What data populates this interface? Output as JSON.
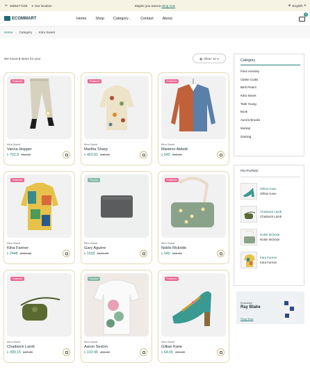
{
  "topbar": {
    "phone": "1555477155",
    "location": "Our location",
    "promo_text": "Maybe you wanna",
    "promo_link": "shop now",
    "language": "English"
  },
  "header": {
    "logo": "ECOMMART",
    "nav": [
      "Home",
      "Shop",
      "Category",
      "Contact",
      "About"
    ],
    "cart_count": "0"
  },
  "breadcrumb": [
    "Home",
    "Category",
    "Kitra Sweet"
  ],
  "listing": {
    "found_prefix": "We found ",
    "found_count": "9",
    "found_suffix": " items for you!",
    "show_label": "Show: 12"
  },
  "products": [
    {
      "badge": "Featured",
      "vendor": "Kitra Sweet",
      "name": "Vanna Hopper",
      "price": "702.9",
      "old_price": "756.00"
    },
    {
      "badge": "Featured",
      "vendor": "Kitra Sweet",
      "name": "Martha Sharp",
      "price": "453.91",
      "old_price": "505.00"
    },
    {
      "badge": "Featured",
      "vendor": "Kitra Sweet",
      "name": "Marteno Abbott",
      "price": "540",
      "old_price": "600.00"
    },
    {
      "badge": "Featured",
      "vendor": "Kitra Sweet",
      "name": "Kitra Farmer",
      "price": "2448",
      "old_price": "2600.00"
    },
    {
      "badge": "Popular",
      "vendor": "Kitra Sweet",
      "name": "Gary Aguirre",
      "price": "1503",
      "old_price": "1579.00"
    },
    {
      "badge": "Featured",
      "vendor": "Kitra Sweet",
      "name": "Noble Mcbride",
      "price": "540",
      "old_price": "600.00"
    },
    {
      "badge": "Featured",
      "vendor": "Kitra Sweet",
      "name": "Chadwick Lamb",
      "price": "399.15",
      "old_price": "837.00"
    },
    {
      "badge": "Popular",
      "vendor": "Kitra Sweet",
      "name": "Aaron Sexton",
      "price": "102.96",
      "old_price": "486.00"
    },
    {
      "badge": "Featured",
      "vendor": "Kitra Sweet",
      "name": "Gillian Kane",
      "price": "64.65",
      "old_price": "460.00"
    }
  ],
  "currency_symbol": "৳",
  "sidebar": {
    "category_title": "Category",
    "categories": [
      "Fleur Hensley",
      "Clarke Curtis",
      "Berk Peters",
      "Kitra Sweet",
      "Tarik Young",
      "Book",
      "Aurora Brooks",
      "Monitor",
      "Gaming"
    ],
    "featured_title": "FEATURED",
    "featured": [
      {
        "name": "Gillian Kane",
        "vendor": "Gillian Kane"
      },
      {
        "name": "Chadwick Lamb",
        "vendor": "Chadwick Lamb"
      },
      {
        "name": "Noble Mcbride",
        "vendor": "Noble Mcbride"
      },
      {
        "name": "Kitra Farmer",
        "vendor": "Kitra Farmer"
      }
    ],
    "banner_small": "Exclusive",
    "banner_big": "Ray Blake",
    "banner_link": "Shop Now"
  },
  "colors": {
    "accent": "#1e7a72",
    "badge_featured": "#e86a92",
    "badge_popular": "#7fb8a4",
    "topbar_bg": "#f6f3e4"
  }
}
